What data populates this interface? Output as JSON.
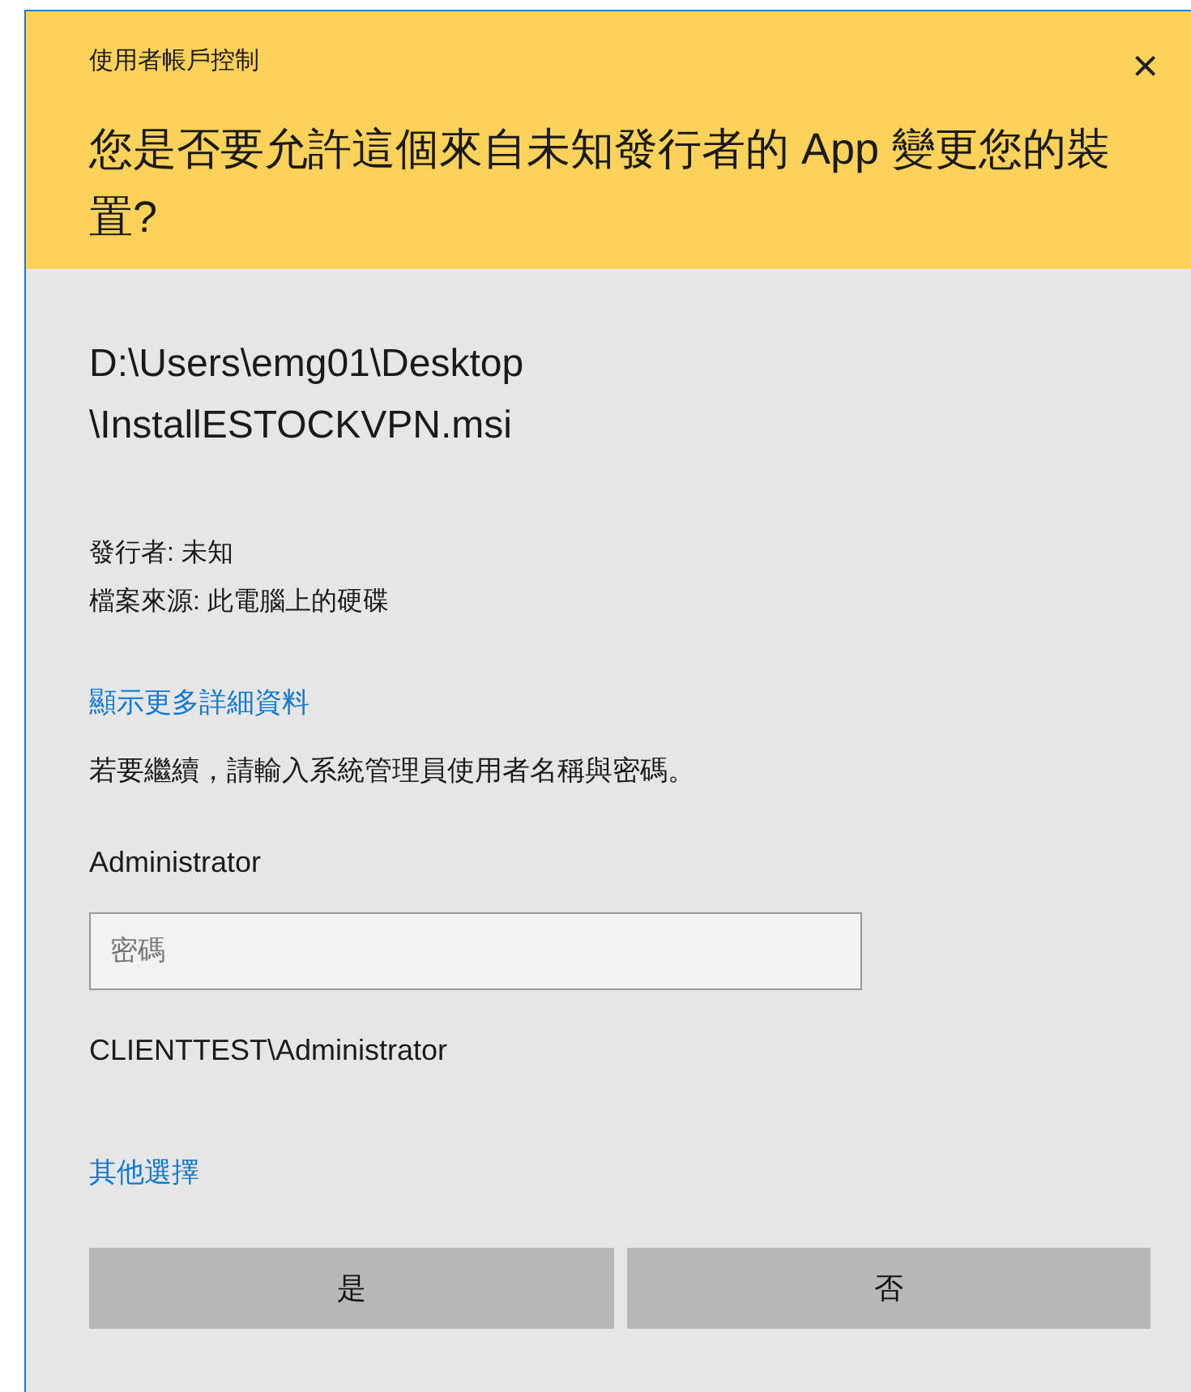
{
  "window": {
    "title": "使用者帳戶控制",
    "close": "×"
  },
  "header": {
    "question": "您是否要允許這個來自未知發行者的 App 變更您的裝置?"
  },
  "program": {
    "path_lines": [
      "D:\\Users\\emg01\\Desktop",
      "\\InstallESTOCKVPN.msi"
    ]
  },
  "details": [
    "發行者: 未知",
    "檔案來源: 此電腦上的硬碟"
  ],
  "show_details_link": "顯示更多詳細資料",
  "instruction": "若要繼續，請輸入系統管理員使用者名稱與密碼。",
  "account": {
    "user_name": "Administrator",
    "password": {
      "placeholder": "密碼"
    },
    "domain_user": "CLIENTTEST\\Administrator"
  },
  "more_choices_link": "其他選擇",
  "buttons": [
    "是",
    "否"
  ]
}
